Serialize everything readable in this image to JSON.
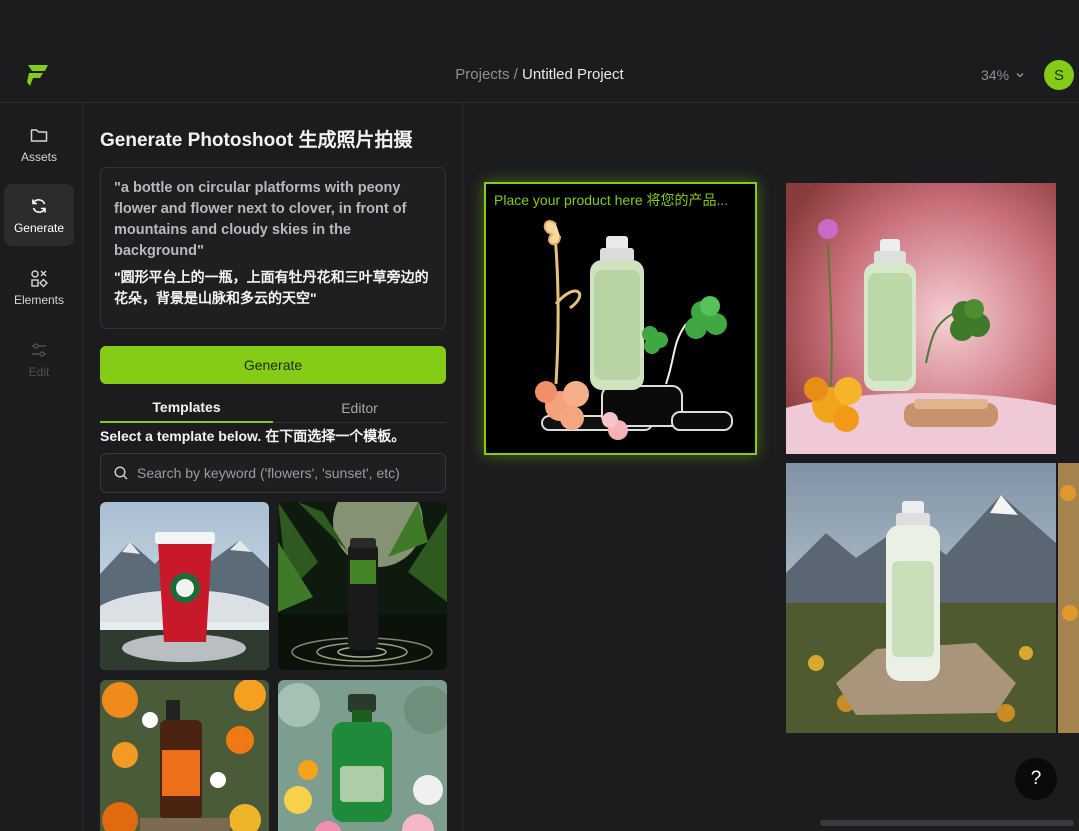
{
  "header": {
    "breadcrumb_root": "Projects",
    "breadcrumb_sep": "/",
    "project_name": "Untitled Project",
    "zoom": "34%",
    "avatar_initial": "S"
  },
  "sidebar": {
    "items": [
      {
        "label": "Assets",
        "icon": "folder-icon"
      },
      {
        "label": "Generate",
        "icon": "refresh-icon"
      },
      {
        "label": "Elements",
        "icon": "shapes-icon"
      },
      {
        "label": "Edit",
        "icon": "sliders-icon"
      }
    ]
  },
  "panel": {
    "title": "Generate Photoshoot 生成照片拍摄",
    "prompt_en": "\"a bottle on circular platforms with peony flower and flower next to clover, in front of mountains and cloudy skies in the background\"",
    "prompt_zh": "\"圆形平台上的一瓶，上面有牡丹花和三叶草旁边的花朵，背景是山脉和多云的天空\"",
    "generate_label": "Generate",
    "tabs": [
      "Templates",
      "Editor"
    ],
    "hint": "Select a template below. 在下面选择一个模板。",
    "search_placeholder": "Search by keyword ('flowers', 'sunset', etc)"
  },
  "canvas": {
    "product_label": "Place your product here 将您的产品...",
    "help_label": "?"
  },
  "colors": {
    "accent": "#84cc16",
    "background": "#1c1c1e"
  }
}
